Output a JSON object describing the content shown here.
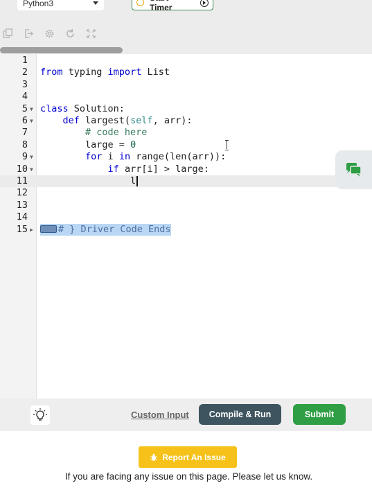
{
  "header": {
    "language_select": "Python3",
    "timer_label": "Start Timer"
  },
  "toolbar": {
    "icons": [
      "copy-icon",
      "export-icon",
      "settings-icon",
      "reset-icon",
      "fullscreen-icon"
    ]
  },
  "editor": {
    "line_numbers": [
      "1",
      "2",
      "3",
      "4",
      "5",
      "6",
      "7",
      "8",
      "9",
      "10",
      "11",
      "12",
      "13",
      "14",
      "15"
    ],
    "lines": {
      "l2_a": "from",
      "l2_b": " typing ",
      "l2_c": "import",
      "l2_d": " List",
      "l5_a": "class",
      "l5_b": " Solution:",
      "l6_indent": "    ",
      "l6_a": "def",
      "l6_b": " largest(",
      "l6_c": "self",
      "l6_d": ", arr):",
      "l7_indent": "        ",
      "l7_a": "# code here",
      "l8_indent": "        ",
      "l8_a": "large = ",
      "l8_b": "0",
      "l9_indent": "        ",
      "l9_a": "for",
      "l9_b": " i ",
      "l9_c": "in",
      "l9_d": " range(len(arr)):",
      "l10_indent": "            ",
      "l10_a": "if",
      "l10_b": " arr[i] > large:",
      "l11_indent": "                ",
      "l11_a": "l",
      "l15_a": "# } Driver Code Ends"
    },
    "active_line": "11"
  },
  "actions": {
    "custom_input": "Custom Input",
    "compile_run": "Compile & Run",
    "submit": "Submit"
  },
  "footer": {
    "report_button": "Report An Issue",
    "note": "If you are facing any issue on this page. Please let us know."
  },
  "colors": {
    "keyword": "#0000cd",
    "comment": "#3a7d5e",
    "submit": "#2f9e44",
    "compile": "#3e5560",
    "report": "#f6c21a"
  }
}
